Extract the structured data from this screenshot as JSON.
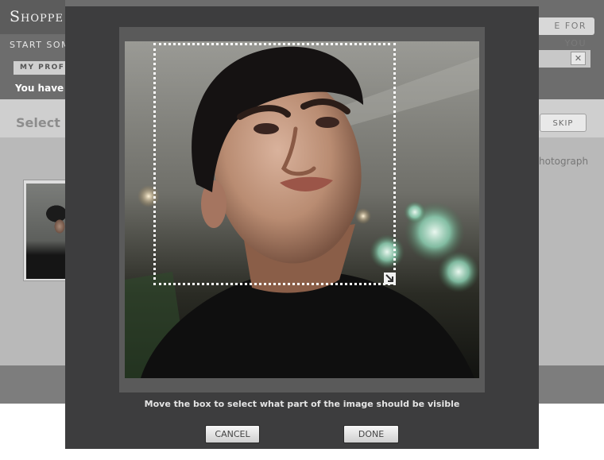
{
  "background_page": {
    "logo": "Shoppe",
    "tagline": "START SOM",
    "profile_tab": "MY PROFI",
    "notice": "You have ca",
    "for_you_button": "E FOR YOU",
    "search_clear_glyph": "✕",
    "select_title": "Select p",
    "skip_button": "SKIP",
    "photo_hint": "hotograph"
  },
  "crop_dialog": {
    "instructions": "Move the box to select what part of the image should be visible",
    "cancel_label": "CANCEL",
    "done_label": "DONE"
  },
  "colors": {
    "modal_background": "#3d3d3e",
    "crop_frame": "#5a5a5a",
    "crop_box_border": "#ffffff"
  }
}
